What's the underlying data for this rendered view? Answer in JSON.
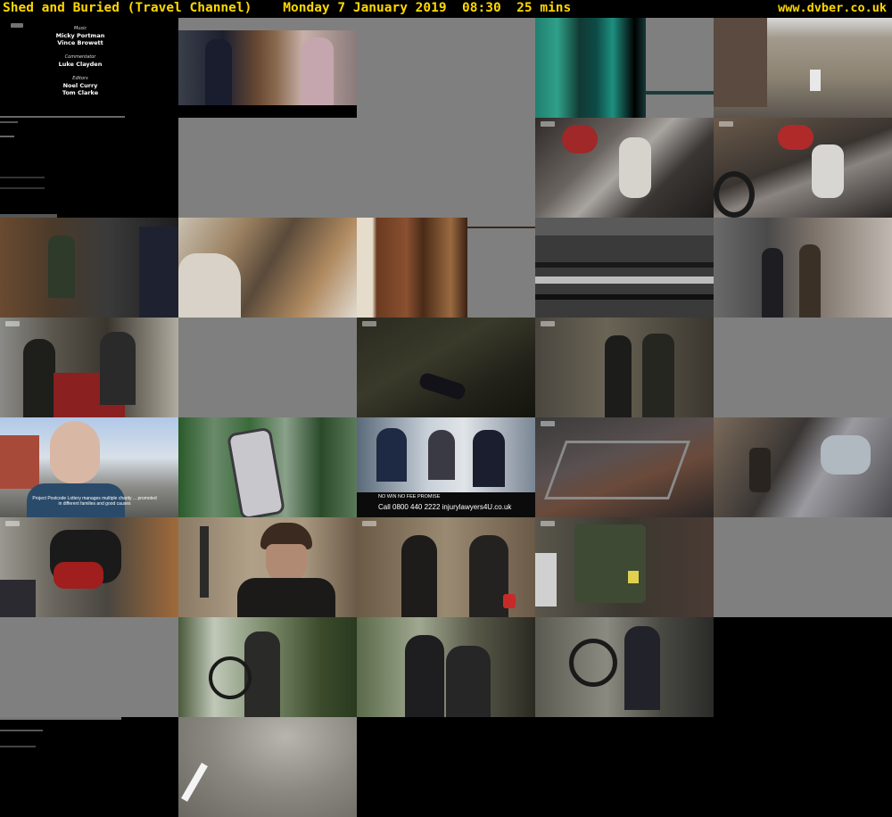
{
  "header": {
    "title": "Shed and Buried (Travel Channel)    Monday 7 January 2019  08:30  25 mins",
    "site": "www.dvber.co.uk"
  },
  "colors": {
    "header_text": "#ffd700",
    "background": "#000000",
    "blank_cell": "#7f7f7f"
  },
  "credits": [
    {
      "role": "Music",
      "names": "Micky Portman\nVince Browett"
    },
    {
      "role": "Commentator",
      "names": "Luke Clayden"
    },
    {
      "role": "Editors",
      "names": "Noel Curry\nTom Clarke"
    }
  ],
  "ad": {
    "line1": "NO WIN NO FEE PROMISE",
    "line2": "Call 0800 440 2222   injurylawyers4U.co.uk"
  },
  "caption": "Project Postcode Lottery manages multiple charity ... promoted in different families and good causes"
}
